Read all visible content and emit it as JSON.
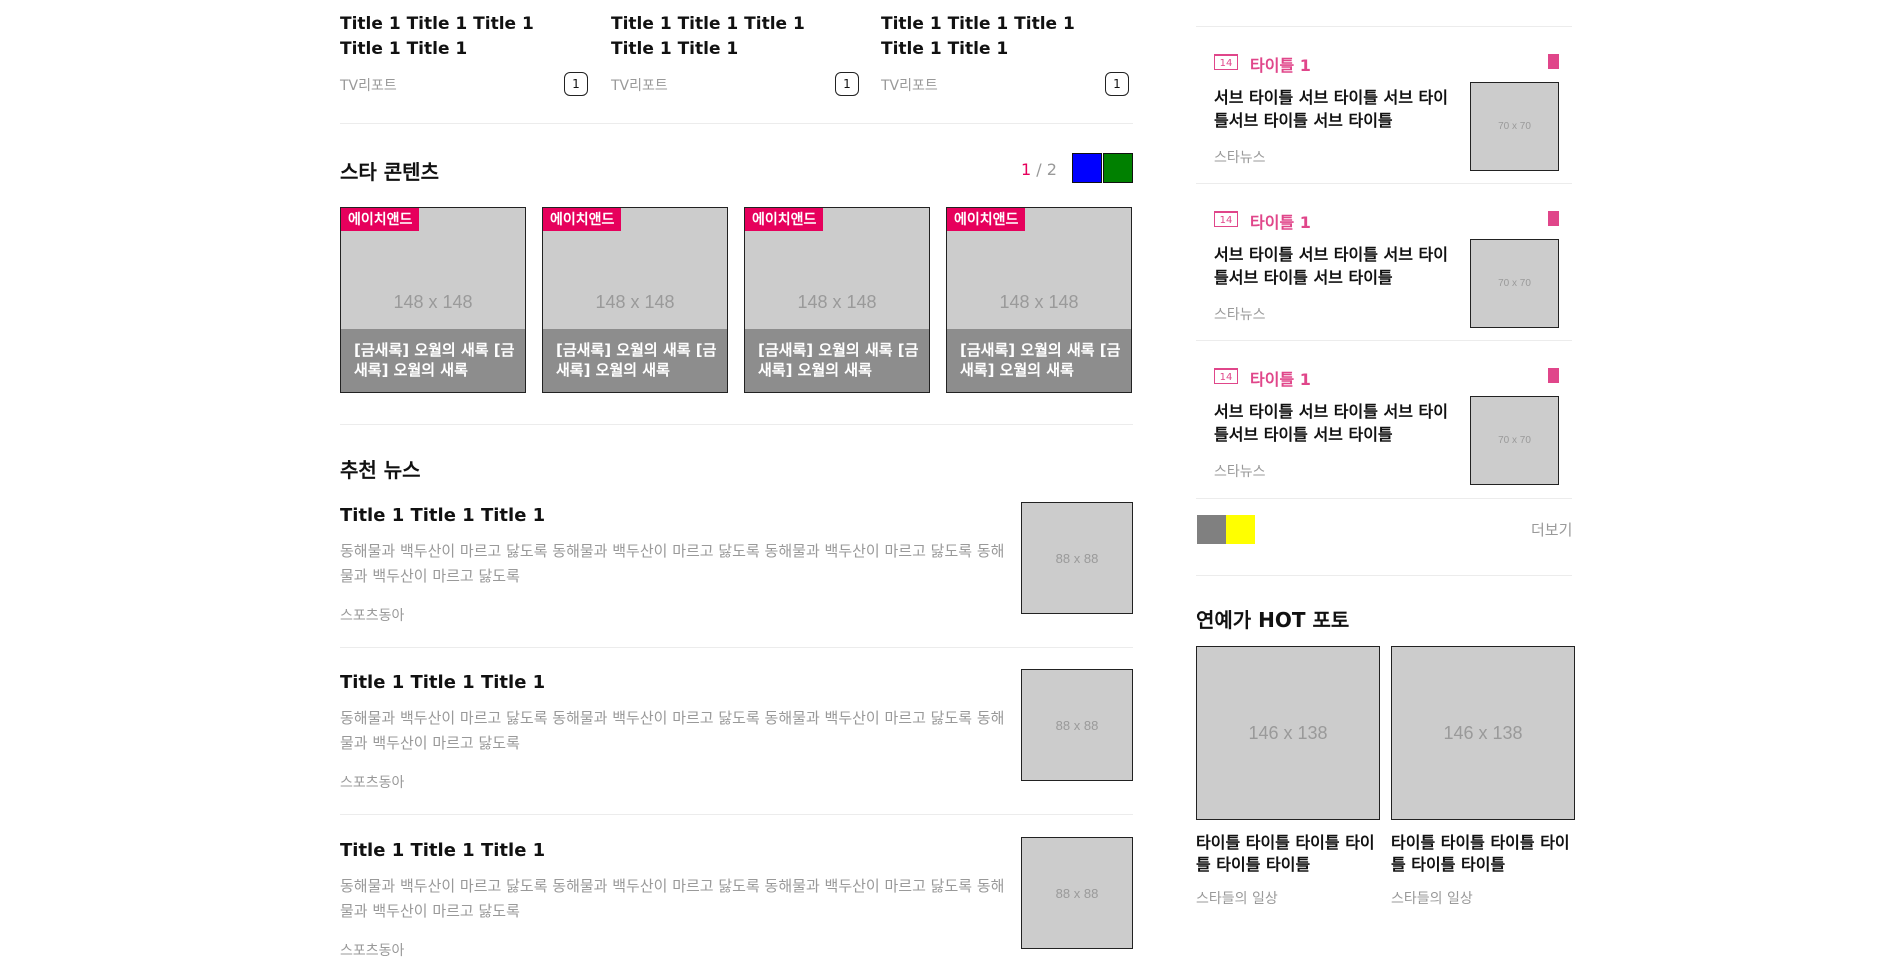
{
  "top_articles": [
    {
      "title": "Title 1 Title 1 Title 1 Title 1 Title 1",
      "source": "TV리포트",
      "count": "1"
    },
    {
      "title": "Title 1 Title 1 Title 1 Title 1 Title 1",
      "source": "TV리포트",
      "count": "1"
    },
    {
      "title": "Title 1 Title 1 Title 1 Title 1 Title 1",
      "source": "TV리포트",
      "count": "1"
    }
  ],
  "star_contents": {
    "title": "스타 콘텐츠",
    "page_current": "1",
    "page_separator": " / ",
    "page_total": "2",
    "prev_color": "#0000ff",
    "next_color": "#008000",
    "cards": [
      {
        "badge": "에이치앤드",
        "size": "148 x 148",
        "caption": "[금새록] 오월의 새록 [금새록] 오월의 새록"
      },
      {
        "badge": "에이치앤드",
        "size": "148 x 148",
        "caption": "[금새록] 오월의 새록 [금새록] 오월의 새록"
      },
      {
        "badge": "에이치앤드",
        "size": "148 x 148",
        "caption": "[금새록] 오월의 새록 [금새록] 오월의 새록"
      },
      {
        "badge": "에이치앤드",
        "size": "148 x 148",
        "caption": "[금새록] 오월의 새록 [금새록] 오월의 새록"
      }
    ]
  },
  "recommended_news": {
    "title": "추천 뉴스",
    "items": [
      {
        "title": "Title 1 Title 1 Title 1",
        "desc": "동해물과 백두산이 마르고 닳도록 동해물과 백두산이 마르고 닳도록 동해물과 백두산이 마르고 닳도록 동해물과 백두산이 마르고 닳도록",
        "source": "스포츠동아",
        "thumb": "88 x 88"
      },
      {
        "title": "Title 1 Title 1 Title 1",
        "desc": "동해물과 백두산이 마르고 닳도록 동해물과 백두산이 마르고 닳도록 동해물과 백두산이 마르고 닳도록 동해물과 백두산이 마르고 닳도록",
        "source": "스포츠동아",
        "thumb": "88 x 88"
      },
      {
        "title": "Title 1 Title 1 Title 1",
        "desc": "동해물과 백두산이 마르고 닳도록 동해물과 백두산이 마르고 닳도록 동해물과 백두산이 마르고 닳도록 동해물과 백두산이 마르고 닳도록",
        "source": "스포츠동아",
        "thumb": "88 x 88"
      }
    ]
  },
  "sidebar_list": {
    "items": [
      {
        "rank": "14",
        "keyword": "타이틀 1",
        "title": "서브 타이틀 서브 타이틀 서브 타이틀서브 타이틀 서브 타이틀",
        "source": "스타뉴스",
        "thumb": "70 x 70"
      },
      {
        "rank": "14",
        "keyword": "타이틀 1",
        "title": "서브 타이틀 서브 타이틀 서브 타이틀서브 타이틀 서브 타이틀",
        "source": "스타뉴스",
        "thumb": "70 x 70"
      },
      {
        "rank": "14",
        "keyword": "타이틀 1",
        "title": "서브 타이틀 서브 타이틀 서브 타이틀서브 타이틀 서브 타이틀",
        "source": "스타뉴스",
        "thumb": "70 x 70"
      }
    ],
    "prev_color": "#808080",
    "next_color": "#ffff00",
    "more_label": "더보기"
  },
  "hot_photos": {
    "title": "연예가 HOT 포토",
    "items": [
      {
        "size": "146 x 138",
        "title": "타이틀 타이틀 타이틀 타이틀 타이틀 타이틀",
        "source": "스타들의 일상"
      },
      {
        "size": "146 x 138",
        "title": "타이틀 타이틀 타이틀 타이틀 타이틀 타이틀",
        "source": "스타들의 일상"
      }
    ]
  },
  "colors": {
    "accent": "#e6005c",
    "keyword": "#e0468a"
  }
}
